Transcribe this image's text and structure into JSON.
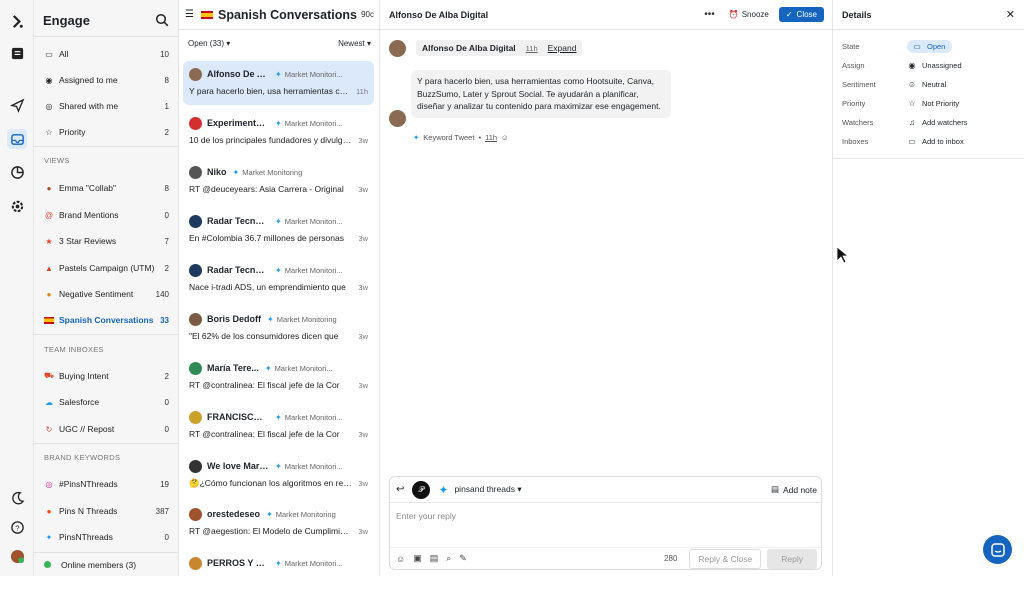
{
  "app": {
    "title": "Engage"
  },
  "sidebar": {
    "items": [
      {
        "label": "All",
        "count": "10",
        "icon": "inbox-icon"
      },
      {
        "label": "Assigned to me",
        "count": "8",
        "icon": "person-icon"
      },
      {
        "label": "Shared with me",
        "count": "1",
        "icon": "share-icon"
      },
      {
        "label": "Priority",
        "count": "2",
        "icon": "star-icon"
      }
    ],
    "views_header": "VIEWS",
    "views": [
      {
        "label": "Emma \"Collab\"",
        "count": "8"
      },
      {
        "label": "Brand Mentions",
        "count": "0"
      },
      {
        "label": "3 Star Reviews",
        "count": "7"
      },
      {
        "label": "Pastels Campaign (UTM)",
        "count": "2"
      },
      {
        "label": "Negative Sentiment",
        "count": "140"
      },
      {
        "label": "Spanish Conversations",
        "count": "33"
      }
    ],
    "team_header": "TEAM INBOXES",
    "team": [
      {
        "label": "Buying Intent",
        "count": "2"
      },
      {
        "label": "Salesforce",
        "count": "0"
      },
      {
        "label": "UGC // Repost",
        "count": "0"
      }
    ],
    "brand_header": "BRAND KEYWORDS",
    "brand": [
      {
        "label": "#PinsNThreads",
        "count": "19"
      },
      {
        "label": "Pins N Threads",
        "count": "387"
      },
      {
        "label": "PinsNThreads",
        "count": "0"
      }
    ],
    "online": "Online members (3)"
  },
  "list": {
    "title": "Spanish Conversations",
    "count_badge": "90c",
    "filter": "Open (33) ▾",
    "sort": "Newest ▾",
    "items": [
      {
        "name": "Alfonso De Al...",
        "source": "Market Monitori...",
        "preview": "Y para hacerlo bien, usa herramientas como Hootsuite",
        "time": "11h",
        "color": "#8a6a52"
      },
      {
        "name": "Experimenta ...",
        "source": "Market Monitori...",
        "preview": "10 de los principales fundadores y divulgadores",
        "time": "3w",
        "color": "#d32f2f"
      },
      {
        "name": "Niko",
        "source": "Market Monitoring",
        "preview": "RT @deuceyears: Asia Carrera - Original",
        "time": "3w",
        "color": "#555555"
      },
      {
        "name": "Radar Tecnol...",
        "source": "Market Monitori...",
        "preview": "En #Colombia 36.7 millones de personas",
        "time": "3w",
        "color": "#1f3a5f"
      },
      {
        "name": "Radar Tecnol...",
        "source": "Market Monitori...",
        "preview": "Nace i-tradi ADS, un emprendimiento que",
        "time": "3w",
        "color": "#1f3a5f"
      },
      {
        "name": "Boris Dedoff",
        "source": "Market Monitoring",
        "preview": "\"El 62% de los consumidores dicen que",
        "time": "3w",
        "color": "#7a5c45"
      },
      {
        "name": "María Tere...",
        "source": "Market Monitori...",
        "preview": "RT @contralinea: El fiscal jefe de la Cor",
        "time": "3w",
        "color": "#2e8b57"
      },
      {
        "name": "FRANCISCO ...",
        "source": "Market Monitori...",
        "preview": "RT @contralinea: El fiscal jefe de la Cor",
        "time": "3w",
        "color": "#c9a227"
      },
      {
        "name": "We love Mark...",
        "source": "Market Monitori...",
        "preview": "🤔¿Cómo funcionan los algoritmos en redes",
        "time": "3w",
        "color": "#333333"
      },
      {
        "name": "orestedeseo",
        "source": "Market Monitoring",
        "preview": "RT @aegestion: El Modelo de Cumplimiento",
        "time": "3w",
        "color": "#a0522d"
      },
      {
        "name": "PERROS Y LE...",
        "source": "Market Monitori...",
        "preview": "",
        "time": "",
        "color": "#c8872e"
      }
    ]
  },
  "main": {
    "header_title": "Alfonso De Alba Digital",
    "more": "•••",
    "snooze": "Snooze",
    "close": "Close",
    "author": "Alfonso De Alba Digital",
    "time": "11h",
    "expand": "Expand",
    "message": "Y para hacerlo bien, usa herramientas como Hootsuite, Canva, BuzzSumo, Later y Sprout Social. Te ayudarán a planificar, diseñar y analizar tu contenido para maximizar ese engagement.",
    "meta_type": "Keyword Tweet",
    "meta_time": "11h",
    "composer": {
      "account": "pinsand threads",
      "add_note": "Add note",
      "placeholder": "Enter your reply",
      "char_count": "280",
      "reply_close": "Reply & Close",
      "reply": "Reply"
    }
  },
  "details": {
    "title": "Details",
    "rows": [
      {
        "label": "State",
        "value": "Open",
        "icon": "inbox-icon"
      },
      {
        "label": "Assign",
        "value": "Unassigned",
        "icon": "person-icon"
      },
      {
        "label": "Sentiment",
        "value": "Neutral",
        "icon": "smiley-icon"
      },
      {
        "label": "Priority",
        "value": "Not Priority",
        "icon": "star-icon"
      },
      {
        "label": "Watchers",
        "value": "Add watchers",
        "icon": "bell-icon"
      },
      {
        "label": "Inboxes",
        "value": "Add to inbox",
        "icon": "inbox-icon"
      }
    ]
  },
  "colors": {
    "accent": "#1565c0",
    "selected": "#dbe9fb",
    "twitter": "#1d9bf0"
  }
}
